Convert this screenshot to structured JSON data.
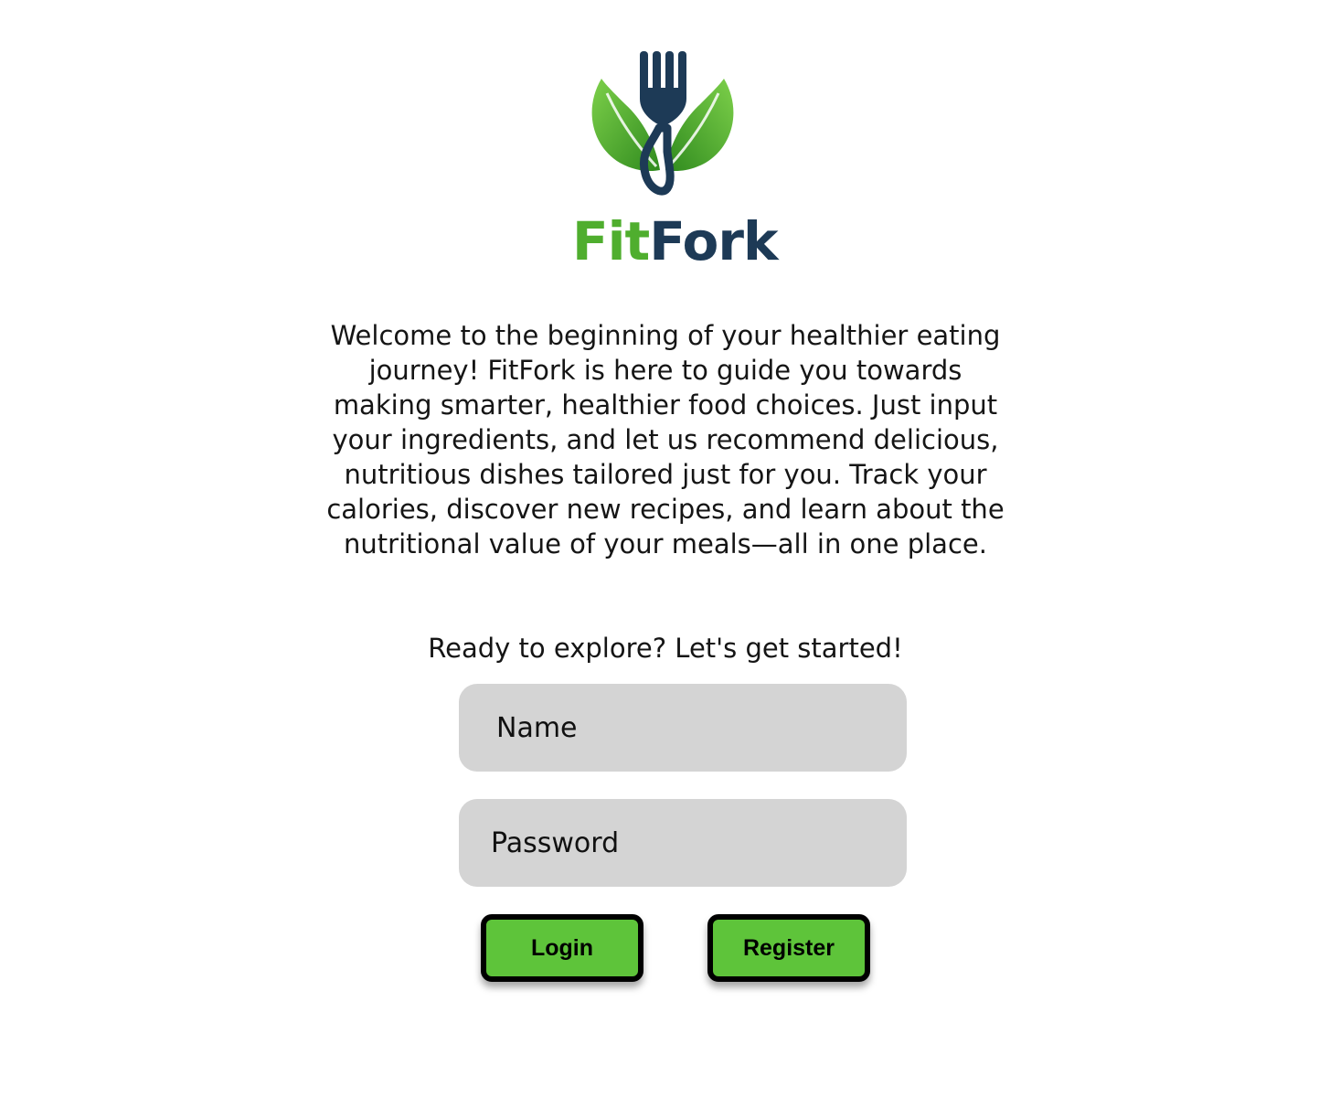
{
  "logo": {
    "wordmark_part1": "Fit",
    "wordmark_part2": "Fork",
    "colors": {
      "green": "#4fae2e",
      "navy": "#1d3a56",
      "leaf_light": "#7dd04a",
      "leaf_dark": "#2f8a1e"
    },
    "icons": [
      "fork-icon",
      "leaf-left-icon",
      "leaf-right-icon"
    ]
  },
  "intro": {
    "text": "Welcome to the beginning of your healthier eating journey! FitFork is here to guide you towards making smarter, healthier food choices. Just input your ingredients, and let us recommend delicious, nutritious dishes tailored just for you. Track your calories, discover new recipes, and learn about the nutritional value of your meals—all in one place."
  },
  "cta": {
    "text": "Ready to explore? Let's get started!"
  },
  "form": {
    "name_placeholder": "Name",
    "password_placeholder": "Password",
    "login_label": "Login",
    "register_label": "Register"
  },
  "colors": {
    "field_background": "#d4d4d4",
    "button_background": "#5ec43a",
    "button_border": "#000000"
  }
}
